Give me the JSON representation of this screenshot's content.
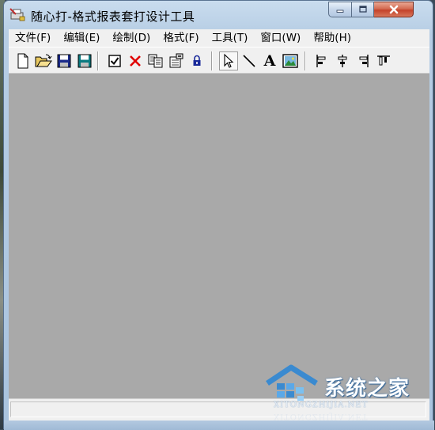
{
  "window": {
    "title": "随心打-格式报表套打设计工具",
    "controls": {
      "minimize": "minimize",
      "maximize": "maximize",
      "close": "close"
    }
  },
  "menu": [
    {
      "label": "文件(F)"
    },
    {
      "label": "编辑(E)"
    },
    {
      "label": "绘制(D)"
    },
    {
      "label": "格式(F)"
    },
    {
      "label": "工具(T)"
    },
    {
      "label": "窗口(W)"
    },
    {
      "label": "帮助(H)"
    }
  ],
  "toolbar": {
    "buttons": [
      {
        "icon": "new-document-icon"
      },
      {
        "icon": "open-folder-icon"
      },
      {
        "icon": "save-icon"
      },
      {
        "icon": "save-as-icon"
      },
      {
        "icon": "checkbox-icon"
      },
      {
        "icon": "delete-icon"
      },
      {
        "icon": "copy-icon"
      },
      {
        "icon": "properties-icon"
      },
      {
        "icon": "lock-icon"
      },
      {
        "icon": "select-pointer-icon",
        "pressed": true
      },
      {
        "icon": "line-tool-icon"
      },
      {
        "icon": "text-tool-icon",
        "glyph": "A"
      },
      {
        "icon": "image-tool-icon"
      },
      {
        "icon": "align-left-icon"
      },
      {
        "icon": "align-center-icon"
      },
      {
        "icon": "align-right-icon"
      },
      {
        "icon": "align-top-icon"
      }
    ]
  },
  "watermark": {
    "brand": "系统之家",
    "url": "XITONGZHIJIA.NET"
  },
  "colors": {
    "workspace": "#a9a9a9",
    "chrome": "#f0f0f0",
    "close_button": "#c4422a",
    "delete_icon": "#e00000",
    "save_icon": "#1a2a8a"
  }
}
